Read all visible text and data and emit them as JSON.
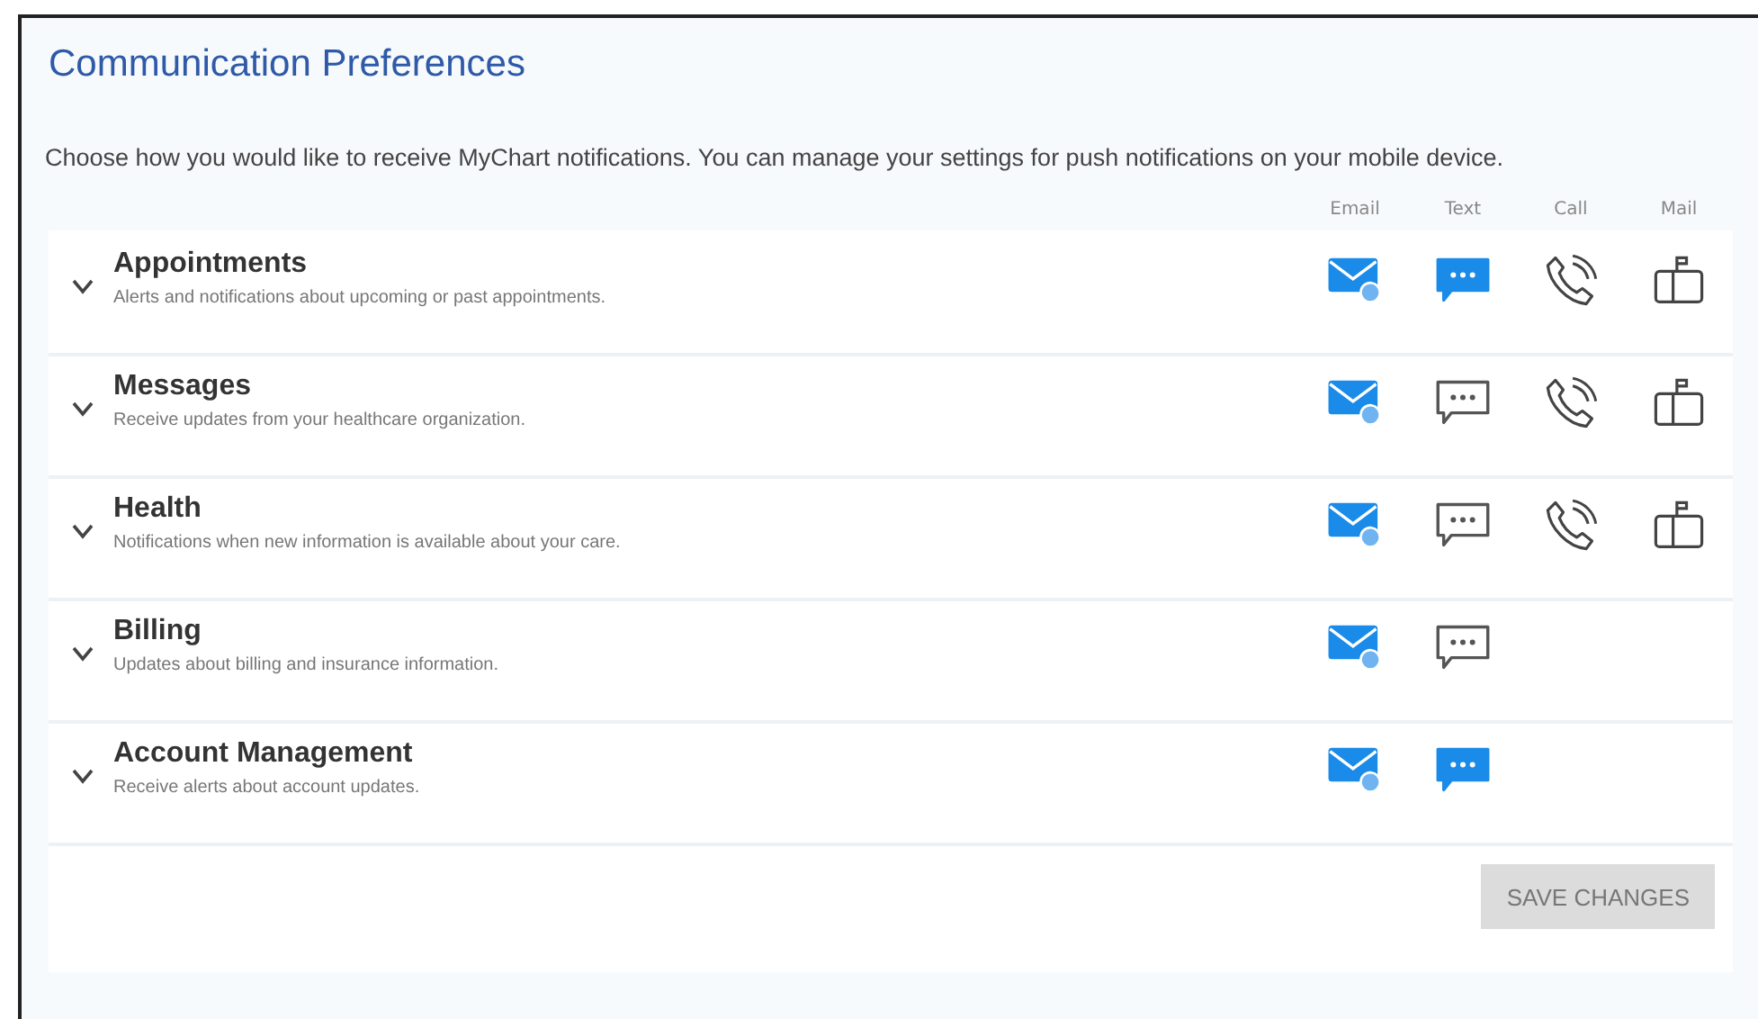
{
  "title": "Communication Preferences",
  "description": "Choose how you would like to receive MyChart notifications. You can manage your settings for push notifications on your mobile device.",
  "columns": [
    {
      "kind": "email",
      "label": "Email"
    },
    {
      "kind": "text",
      "label": "Text"
    },
    {
      "kind": "call",
      "label": "Call"
    },
    {
      "kind": "mail",
      "label": "Mail"
    }
  ],
  "categories": [
    {
      "name": "Appointments",
      "description": "Alerts and notifications about upcoming or past appointments.",
      "expanded": false,
      "channels": [
        {
          "kind": "email",
          "on": true
        },
        {
          "kind": "text",
          "on": true
        },
        {
          "kind": "call",
          "on": false
        },
        {
          "kind": "mail",
          "on": false
        }
      ]
    },
    {
      "name": "Messages",
      "description": "Receive updates from your healthcare organization.",
      "expanded": false,
      "channels": [
        {
          "kind": "email",
          "on": true
        },
        {
          "kind": "text",
          "on": false
        },
        {
          "kind": "call",
          "on": false
        },
        {
          "kind": "mail",
          "on": false
        }
      ]
    },
    {
      "name": "Health",
      "description": "Notifications when new information is available about your care.",
      "expanded": false,
      "channels": [
        {
          "kind": "email",
          "on": true
        },
        {
          "kind": "text",
          "on": false
        },
        {
          "kind": "call",
          "on": false
        },
        {
          "kind": "mail",
          "on": false
        }
      ]
    },
    {
      "name": "Billing",
      "description": "Updates about billing and insurance information.",
      "expanded": false,
      "channels": [
        {
          "kind": "email",
          "on": true
        },
        {
          "kind": "text",
          "on": false
        }
      ]
    },
    {
      "name": "Account Management",
      "description": "Receive alerts about account updates.",
      "expanded": false,
      "channels": [
        {
          "kind": "email",
          "on": true
        },
        {
          "kind": "text",
          "on": true
        }
      ]
    }
  ],
  "save_button": {
    "label": "SAVE CHANGES",
    "disabled": true
  }
}
